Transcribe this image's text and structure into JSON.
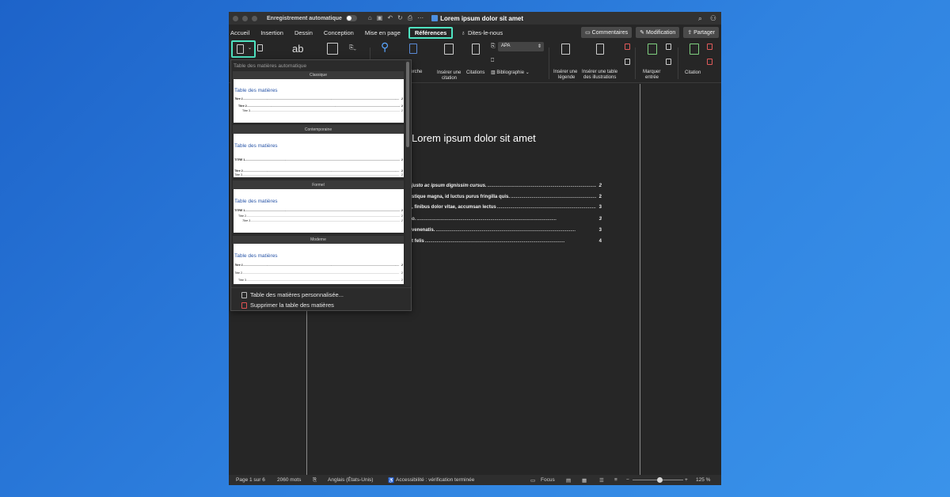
{
  "titlebar": {
    "autosave_label": "Enregistrement automatique",
    "document_title": "Lorem ipsum dolor sit amet"
  },
  "tabs": [
    {
      "label": "Accueil"
    },
    {
      "label": "Insertion"
    },
    {
      "label": "Dessin"
    },
    {
      "label": "Conception"
    },
    {
      "label": "Mise en page"
    },
    {
      "label": "Références"
    }
  ],
  "tell_me": "Dites-le-nous",
  "tab_buttons": {
    "comments": "Commentaires",
    "modification": "Modification",
    "share": "Partager"
  },
  "ribbon": {
    "search_partial": "herche",
    "insert_citation_1": "Insérer une",
    "insert_citation_2": "citation",
    "citations": "Citations",
    "style_value": "APA",
    "bibliography": "Bibliographie",
    "insert_caption_1": "Insérer une",
    "insert_caption_2": "légende",
    "insert_table_1": "Insérer une table",
    "insert_table_2": "des illustrations",
    "mark_entry_1": "Marquer",
    "mark_entry_2": "entrée",
    "citation": "Citation",
    "ab_label": "ab"
  },
  "dropdown": {
    "title": "Table des matières automatique",
    "styles": [
      {
        "label": "Classique",
        "toc_title": "Table des matières",
        "lines": [
          {
            "text": "Titre 1",
            "num": "2"
          },
          {
            "text": "Titre 2",
            "num": "2"
          },
          {
            "text": "Titre 3",
            "num": "2"
          }
        ]
      },
      {
        "label": "Contemporaine",
        "toc_title": "Table des matières",
        "lines": [
          {
            "text": "TITRE 1",
            "num": "2"
          },
          {
            "text": "Titre 2",
            "num": "2"
          },
          {
            "text": "Titre 3",
            "num": "2"
          }
        ]
      },
      {
        "label": "Formel",
        "toc_title": "Table des matières",
        "lines": [
          {
            "text": "TITRE 1",
            "num": "2"
          },
          {
            "text": "Titre 2",
            "num": "2"
          },
          {
            "text": "Titre 3",
            "num": "2"
          }
        ]
      },
      {
        "label": "Moderne",
        "toc_title": "Table des matières",
        "lines": [
          {
            "text": "Titre 1",
            "num": "2"
          },
          {
            "text": "Titre 2",
            "num": "2"
          },
          {
            "text": "Titre 3",
            "num": "2"
          }
        ]
      }
    ],
    "custom_toc": "Table des matières personnalisée...",
    "remove_toc": "Supprimer la table des matières"
  },
  "document": {
    "heading": "Lorem ipsum dolor sit amet",
    "toc_entries": [
      {
        "text": "justo ac ipsum dignissim cursus.",
        "num": "2"
      },
      {
        "text": "stique magna, id luctus purus fringilla quis.",
        "num": "2"
      },
      {
        "text": ", finibus dolor vitae, accumsan lectus",
        "num": "3"
      },
      {
        "text": "o.",
        "num": "3"
      },
      {
        "text": " venenatis.",
        "num": "3"
      },
      {
        "text": "t felis",
        "num": "4"
      }
    ]
  },
  "statusbar": {
    "page": "Page 1 sur 6",
    "words": "2060 mots",
    "language": "Anglais (États-Unis)",
    "accessibility": "Accessibilité : vérification terminée",
    "focus": "Focus",
    "zoom": "125 %"
  },
  "colors": {
    "highlight": "#4fe3c1",
    "background_blue": "#2f82e0",
    "toc_title_blue": "#2a56a8"
  }
}
